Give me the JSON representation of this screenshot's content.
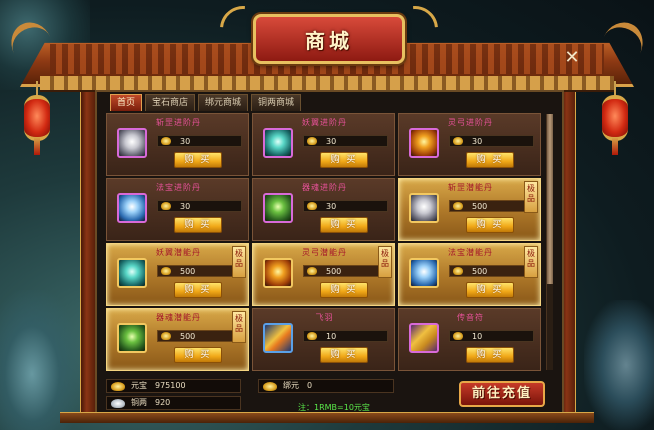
{
  "window": {
    "title": "商城"
  },
  "tabs": [
    {
      "label": "首页",
      "active": true
    },
    {
      "label": "宝石商店",
      "active": false
    },
    {
      "label": "绑元商城",
      "active": false
    },
    {
      "label": "铜两商城",
      "active": false
    }
  ],
  "items": [
    {
      "name": "斩罡进阶丹",
      "price": "30",
      "buy": "购 买",
      "premium": false,
      "icon": "crystal-orb-icon"
    },
    {
      "name": "妖翼进阶丹",
      "price": "30",
      "buy": "购 买",
      "premium": false,
      "icon": "feather-orb-icon"
    },
    {
      "name": "灵弓进阶丹",
      "price": "30",
      "buy": "购 买",
      "premium": false,
      "icon": "bow-orb-icon"
    },
    {
      "name": "法宝进阶丹",
      "price": "30",
      "buy": "购 买",
      "premium": false,
      "icon": "treasure-orb-icon"
    },
    {
      "name": "器魂进阶丹",
      "price": "30",
      "buy": "购 买",
      "premium": false,
      "icon": "soul-orb-icon"
    },
    {
      "name": "斩罡潜能丹",
      "price": "500",
      "buy": "购 买",
      "premium": true,
      "tag": "极品",
      "icon": "silver-orb-icon"
    },
    {
      "name": "妖翼潜能丹",
      "price": "500",
      "buy": "购 买",
      "premium": true,
      "tag": "极品",
      "icon": "teal-orb-icon"
    },
    {
      "name": "灵弓潜能丹",
      "price": "500",
      "buy": "购 买",
      "premium": true,
      "tag": "极品",
      "icon": "orange-orb-icon"
    },
    {
      "name": "法宝潜能丹",
      "price": "500",
      "buy": "购 买",
      "premium": true,
      "tag": "极品",
      "icon": "sky-orb-icon"
    },
    {
      "name": "器魂潜能丹",
      "price": "500",
      "buy": "购 买",
      "premium": true,
      "tag": "极品",
      "icon": "green-orb-icon"
    },
    {
      "name": "飞羽",
      "price": "10",
      "buy": "购 买",
      "premium": false,
      "icon": "wing-icon"
    },
    {
      "name": "传音符",
      "price": "10",
      "buy": "购 买",
      "premium": false,
      "icon": "scroll-icon"
    }
  ],
  "currency": {
    "yuanbao_label": "元宝",
    "yuanbao_value": "975100",
    "tongliang_label": "铜两",
    "tongliang_value": "920",
    "bangyuan_label": "绑元",
    "bangyuan_value": "0"
  },
  "note": "注：1RMB=10元宝",
  "recharge_button": "前往充值",
  "colors": {
    "accent": "#c63a28",
    "gold": "#d8a848",
    "item_name": "#e8529a",
    "note": "#5ae84a"
  }
}
